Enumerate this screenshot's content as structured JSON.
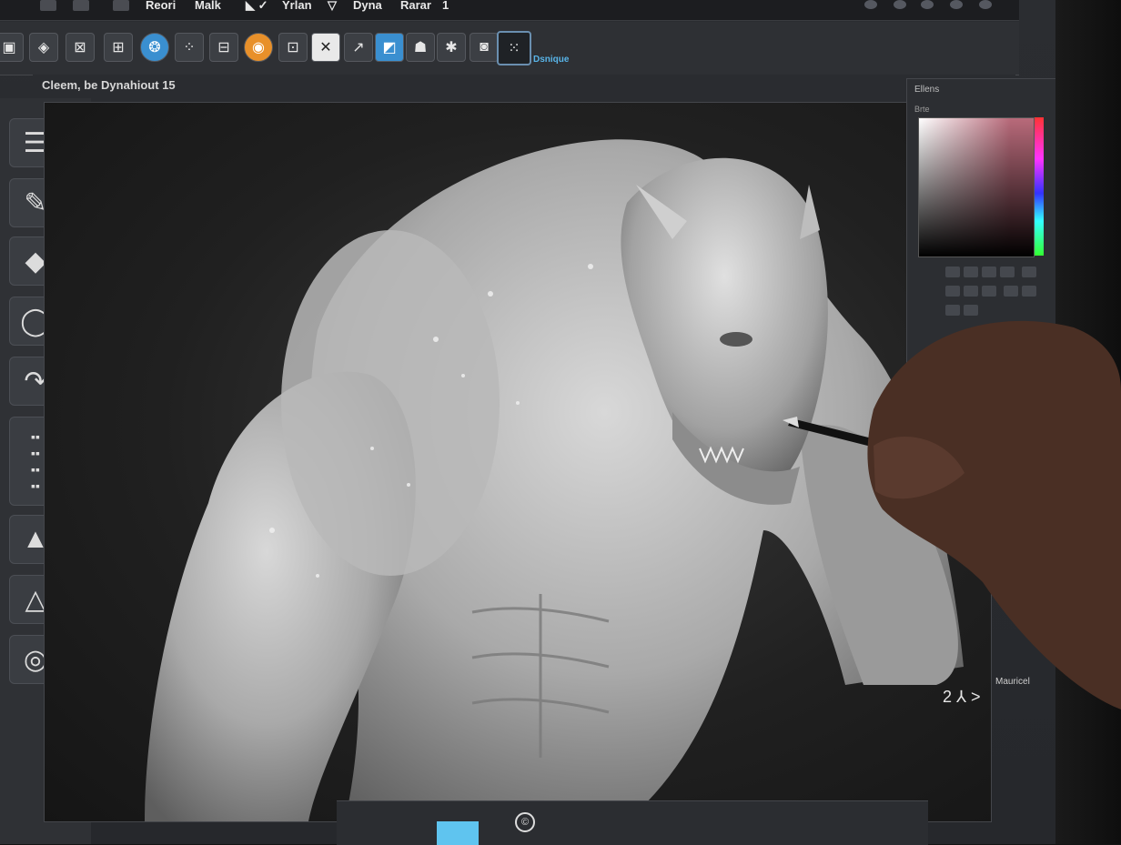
{
  "menubar": {
    "items": [
      "Reori",
      "Malk",
      "Yrlan",
      "Dyna",
      "Rarar"
    ],
    "arrows": [
      "✓",
      "✓",
      "▽"
    ],
    "tail": "1"
  },
  "toolbar": {
    "tools": [
      "select-icon",
      "rotate-icon",
      "scale-icon",
      "mesh-icon",
      "drop-icon",
      "dots-icon",
      "grid-icon",
      "orange-brush-icon",
      "frame-icon",
      "pen-icon",
      "stroke-icon",
      "blue-icon",
      "move-icon",
      "paint-icon",
      "layer-icon",
      "dots-active-icon"
    ],
    "label": "Dsnique"
  },
  "document": {
    "title": "Cleem, be Dynahiout 15"
  },
  "left_tools": [
    "layers-icon",
    "brush-icon",
    "diamond-icon",
    "circle-icon",
    "curve-icon",
    "keypad-icon",
    "triangle-icon",
    "triangle-outline-icon",
    "target-icon"
  ],
  "right_panel": {
    "title": "Ellens",
    "subtitle": "Brte"
  },
  "status": {
    "zoom": "2 ⅄ >",
    "tag": "Mauricel"
  },
  "colors": {
    "accent": "#58b4e8",
    "orange": "#e8902a",
    "blue": "#3a8fd0"
  }
}
